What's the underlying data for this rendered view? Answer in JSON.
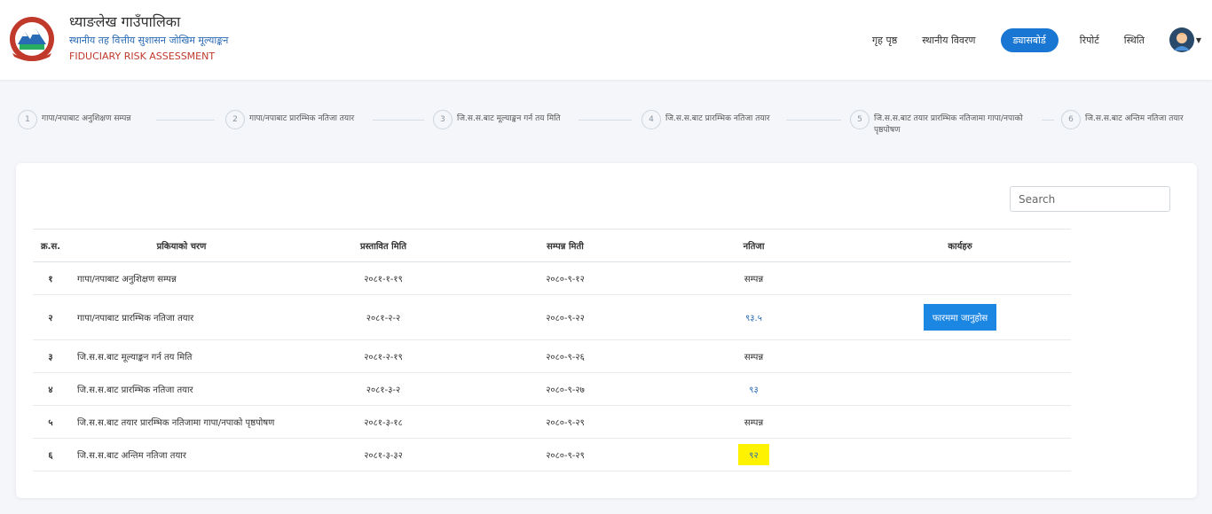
{
  "brand": {
    "title": "ध्याङलेख गाउँपालिका",
    "subtitle": "स्थानीय तह वित्तीय सुशासन जोखिम मूल्याङ्कन",
    "english": "FIDUCIARY RISK ASSESSMENT"
  },
  "nav": {
    "home": "गृह पृष्ठ",
    "local_details": "स्थानीय विवरण",
    "dashboard": "ड्यासबोर्ड",
    "report": "रिपोर्ट",
    "status": "स्थिति"
  },
  "steps": [
    {
      "num": "1",
      "label": "गापा/नपाबाट अनुशिक्षण सम्पन्न"
    },
    {
      "num": "2",
      "label": "गापा/नपाबाट प्रारम्भिक नतिजा तयार"
    },
    {
      "num": "3",
      "label": "जि.स.स.बाट मूल्याङ्कन गर्न तय मिति"
    },
    {
      "num": "4",
      "label": "जि.स.स.बाट प्रारम्भिक नतिजा तयार"
    },
    {
      "num": "5",
      "label": "जि.स.स.बाट तयार प्रारम्भिक नतिजामा गापा/नपाको पृष्ठपोषण"
    },
    {
      "num": "6",
      "label": "जि.स.स.बाट अन्तिम नतिजा तयार"
    }
  ],
  "search": {
    "placeholder": "Search"
  },
  "table": {
    "headers": {
      "sn": "क्र.स.",
      "stage": "प्रकियाको चरण",
      "proposed_date": "प्रस्तावित मिति",
      "completed_date": "सम्पन्न मिती",
      "result": "नतिजा",
      "actions": "कार्यहरु"
    },
    "rows": [
      {
        "sn": "१",
        "stage": "गापा/नपाबाट अनुशिक्षण सम्पन्न",
        "proposed": "२०८१-१-१९",
        "completed": "२०८०-९-१२",
        "result": "सम्पन्न"
      },
      {
        "sn": "२",
        "stage": "गापा/नपाबाट प्रारम्भिक नतिजा तयार",
        "proposed": "२०८१-२-२",
        "completed": "२०८०-९-२२",
        "result": "९३.५",
        "action": "फारममा जानुहोस"
      },
      {
        "sn": "३",
        "stage": "जि.स.स.बाट मूल्याङ्कन गर्न तय मिति",
        "proposed": "२०८१-२-१९",
        "completed": "२०८०-९-२६",
        "result": "सम्पन्न"
      },
      {
        "sn": "४",
        "stage": "जि.स.स.बाट प्रारम्भिक नतिजा तयार",
        "proposed": "२०८१-३-२",
        "completed": "२०८०-९-२७",
        "result": "९३"
      },
      {
        "sn": "५",
        "stage": "जि.स.स.बाट तयार प्रारम्भिक नतिजामा गापा/नपाको पृष्ठपोषण",
        "proposed": "२०८१-३-१८",
        "completed": "२०८०-९-२९",
        "result": "सम्पन्न"
      },
      {
        "sn": "६",
        "stage": "जि.स.स.बाट अन्तिम नतिजा तयार",
        "proposed": "२०८१-३-३२",
        "completed": "२०८०-९-२९",
        "result": "९२"
      }
    ]
  },
  "colors": {
    "accent": "#1976d2",
    "button": "#1c86e3",
    "highlight": "#fff200",
    "brand_red": "#c0392b"
  },
  "icons": {
    "logo": "municipality-emblem-icon",
    "avatar": "user-avatar-icon",
    "caret": "caret-down-icon"
  }
}
